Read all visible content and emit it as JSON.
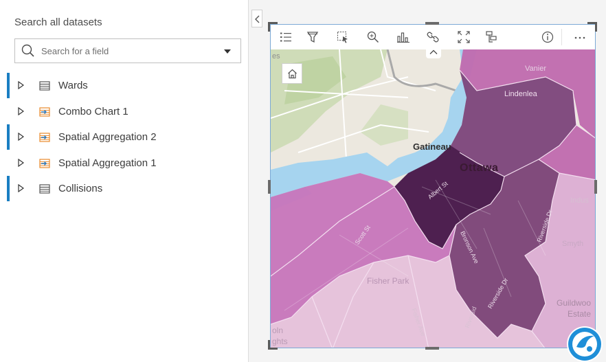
{
  "data_pane": {
    "title": "Search all datasets",
    "search": {
      "placeholder": "Search for a field",
      "value": ""
    },
    "datasets": [
      {
        "label": "Wards",
        "icon": "table-icon",
        "active": true
      },
      {
        "label": "Combo Chart 1",
        "icon": "result-dataset-icon",
        "active": false
      },
      {
        "label": "Spatial Aggregation 2",
        "icon": "result-dataset-icon",
        "active": true
      },
      {
        "label": "Spatial Aggregation 1",
        "icon": "result-dataset-icon",
        "active": false
      },
      {
        "label": "Collisions",
        "icon": "table-icon",
        "active": true
      }
    ]
  },
  "map_card": {
    "toolbar": [
      "legend-icon",
      "filter-icon",
      "select-icon",
      "zoom-icon",
      "visualization-type-icon",
      "link-icon",
      "fit-extent-icon",
      "layer-options-icon",
      "info-icon",
      "more-options-icon"
    ],
    "map_labels": {
      "gatineau": "Gatineau",
      "ottawa": "Ottawa",
      "vanier": "Vanier",
      "lindenlea": "Lindenlea",
      "indus": "Indus",
      "smyth": "Smyth",
      "fisher_park": "Fisher Park",
      "guildwood": "Guildwoo",
      "estates": "Estate",
      "lincoln": "oln",
      "heights": "ghts",
      "es": "es",
      "albert_st": "Albert St",
      "scott_st": "Scott St",
      "bronson_ave": "Bronson Ave",
      "riverside_dr": "Riverside Dr",
      "riverside_dr_2": "Riverside Dr",
      "fisher_ave": "Fisher Ave",
      "river_label": "Riversid"
    }
  },
  "colors": {
    "accent": "#1a7ec2",
    "card_border": "#7ba9d6",
    "darkest": "#4a1d48",
    "dark": "#6f3a6c",
    "medium": "#c768b7",
    "light": "#dcaed3",
    "lightest": "#e9c9df",
    "water": "#a6d4ef"
  }
}
